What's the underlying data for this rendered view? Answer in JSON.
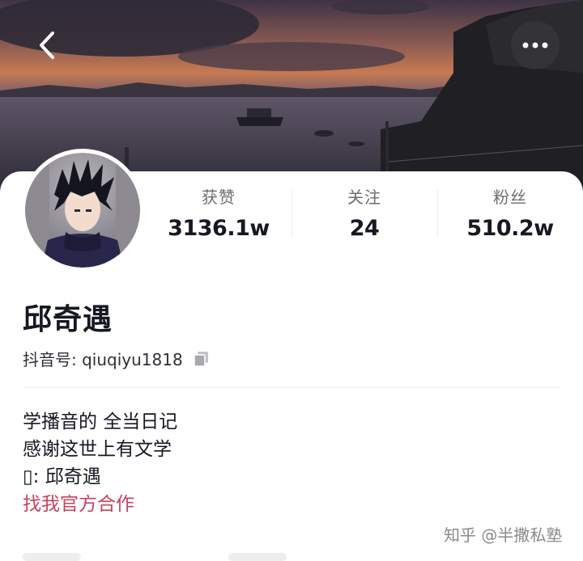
{
  "header": {
    "back_icon": "chevron-left-icon",
    "more_icon": "more-horizontal-icon"
  },
  "stats": [
    {
      "label": "获赞",
      "value": "3136.1w"
    },
    {
      "label": "关注",
      "value": "24"
    },
    {
      "label": "粉丝",
      "value": "510.2w"
    }
  ],
  "profile": {
    "name": "邱奇遇",
    "douyin_id_label": "抖音号: qiuqiyu1818",
    "copy_icon": "copy-icon"
  },
  "bio": {
    "line1": "学播音的 全当日记",
    "line2": "感谢这世上有文学",
    "line3": "▯: 邱奇遇",
    "link": "找我官方合作"
  },
  "watermark": "知乎 @半撒私塾",
  "colors": {
    "link": "#c9415f",
    "primary_text": "#161823",
    "secondary_text": "#6d6d72"
  }
}
